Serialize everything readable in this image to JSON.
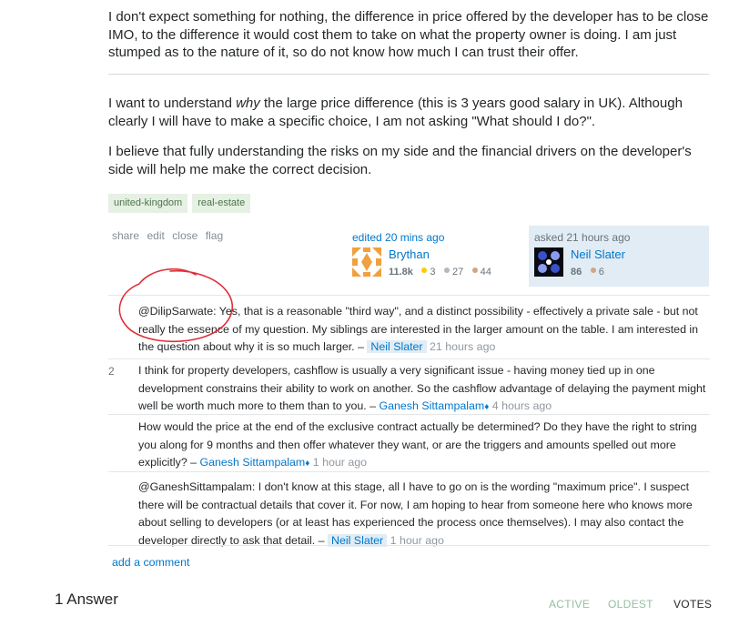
{
  "question": {
    "paragraphs": {
      "p1": "I don't expect something for nothing, the difference in price offered by the developer has to be close IMO, to the difference it would cost them to take on what the property owner is doing. I am just stumped as to the nature of it, so do not know how much I can trust their offer.",
      "p2_before": "I want to understand ",
      "p2_em": "why",
      "p2_after": " the large price difference (this is 3 years good salary in UK). Although clearly I will have to make a specific choice, I am not asking \"What should I do?\".",
      "p3": "I believe that fully understanding the risks on my side and the financial drivers on the developer's side will help me make the correct decision."
    },
    "tags": [
      "united-kingdom",
      "real-estate"
    ],
    "menu": {
      "share": "share",
      "edit": "edit",
      "close": "close",
      "flag": "flag"
    },
    "editor": {
      "label": "edited 20 mins ago",
      "name": "Brythan",
      "rep": "11.8k",
      "gold": "3",
      "silver": "27",
      "bronze": "44"
    },
    "owner": {
      "label": "asked 21 hours ago",
      "name": "Neil Slater",
      "rep": "86",
      "bronze": "6"
    }
  },
  "comments": [
    {
      "score": "",
      "text": "@DilipSarwate: Yes, that is a reasonable \"third way\", and a distinct possibility - effectively a private sale - but not really the essence of my question. My siblings are interested in the larger amount on the table. I am interested in the question about why it is so much larger. –",
      "user": "Neil Slater",
      "age": "21 hours ago"
    },
    {
      "score": "2",
      "text": "I think for property developers, cashflow is usually a very significant issue - having money tied up in one development constrains their ability to work on another. So the cashflow advantage of delaying the payment might well be worth much more to them than to you. –",
      "user": "Ganesh Sittampalam",
      "diamond": "♦",
      "age": "4 hours ago"
    },
    {
      "score": "",
      "text": "How would the price at the end of the exclusive contract actually be determined? Do they have the right to string you along for 9 months and then offer whatever they want, or are the triggers and amounts spelled out more explicitly? –",
      "user": "Ganesh Sittampalam",
      "diamond": "♦",
      "age": "1 hour ago"
    },
    {
      "score": "",
      "text": "@GaneshSittampalam: I don't know at this stage, all I have to go on is the wording \"maximum price\". I suspect there will be contractual details that cover it. For now, I am hoping to hear from someone here who knows more about selling to developers (or at least has experienced the process once themselves). I may also contact the developer directly to ask that detail. –",
      "user": "Neil Slater",
      "age": "1 hour ago"
    }
  ],
  "add_comment": "add a comment",
  "answers": {
    "heading": "1 Answer",
    "sort": [
      "ACTIVE",
      "OLDEST",
      "VOTES"
    ]
  },
  "colors": {
    "link": "#0077cc",
    "annotation": "#e0303a"
  }
}
